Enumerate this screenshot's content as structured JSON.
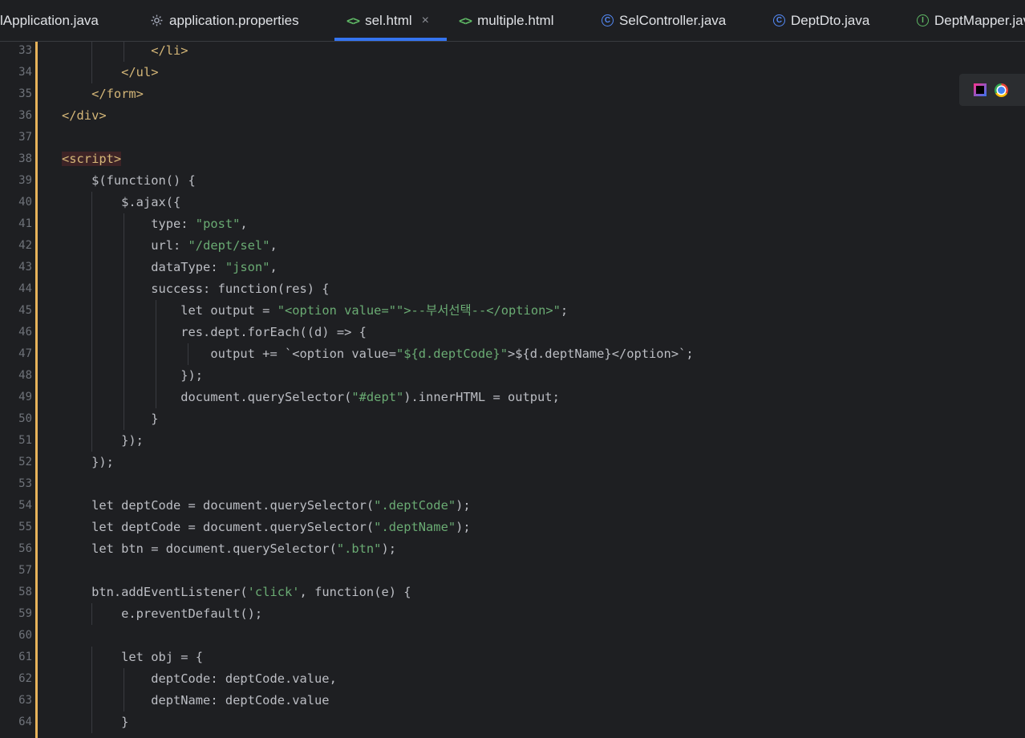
{
  "tabs": [
    {
      "label": "lApplication.java",
      "icon": "none",
      "active": false
    },
    {
      "label": "application.properties",
      "icon": "gear-icon",
      "active": false
    },
    {
      "label": "sel.html",
      "icon": "html-code-icon",
      "active": true,
      "close": "×"
    },
    {
      "label": "multiple.html",
      "icon": "html-code-icon",
      "active": false
    },
    {
      "label": "SelController.java",
      "icon": "class-icon",
      "active": false
    },
    {
      "label": "DeptDto.java",
      "icon": "class-icon",
      "active": false
    },
    {
      "label": "DeptMapper.java",
      "icon": "interface-icon",
      "active": false
    }
  ],
  "editor": {
    "lines": [
      {
        "n": "33",
        "text": "            </li>"
      },
      {
        "n": "34",
        "text": "        </ul>"
      },
      {
        "n": "35",
        "text": "    </form>"
      },
      {
        "n": "36",
        "text": "</div>"
      },
      {
        "n": "37",
        "text": ""
      },
      {
        "n": "38",
        "text": "<script>"
      },
      {
        "n": "39",
        "text": "    $(function() {"
      },
      {
        "n": "40",
        "text": "        $.ajax({"
      },
      {
        "n": "41",
        "text": "            type: \"post\","
      },
      {
        "n": "42",
        "text": "            url: \"/dept/sel\","
      },
      {
        "n": "43",
        "text": "            dataType: \"json\","
      },
      {
        "n": "44",
        "text": "            success: function(res) {"
      },
      {
        "n": "45",
        "text": "                let output = \"<option value=\"\">--부서선택--</option>\";"
      },
      {
        "n": "46",
        "text": "                res.dept.forEach((d) => {"
      },
      {
        "n": "47",
        "text": "                    output += `<option value=\"${d.deptCode}\">${d.deptName}</option>`;"
      },
      {
        "n": "48",
        "text": "                });"
      },
      {
        "n": "49",
        "text": "                document.querySelector(\"#dept\").innerHTML = output;"
      },
      {
        "n": "50",
        "text": "            }"
      },
      {
        "n": "51",
        "text": "        });"
      },
      {
        "n": "52",
        "text": "    });"
      },
      {
        "n": "53",
        "text": ""
      },
      {
        "n": "54",
        "text": "    let deptCode = document.querySelector(\".deptCode\");"
      },
      {
        "n": "55",
        "text": "    let deptCode = document.querySelector(\".deptName\");"
      },
      {
        "n": "56",
        "text": "    let btn = document.querySelector(\".btn\");"
      },
      {
        "n": "57",
        "text": ""
      },
      {
        "n": "58",
        "text": "    btn.addEventListener('click', function(e) {"
      },
      {
        "n": "59",
        "text": "        e.preventDefault();"
      },
      {
        "n": "60",
        "text": ""
      },
      {
        "n": "61",
        "text": "        let obj = {"
      },
      {
        "n": "62",
        "text": "            deptCode: deptCode.value,"
      },
      {
        "n": "63",
        "text": "            deptName: deptCode.value"
      },
      {
        "n": "64",
        "text": "        }"
      }
    ]
  },
  "colors": {
    "background": "#1e1f22",
    "accent": "#3574f0",
    "change_marker": "#e8b35a",
    "string": "#6aab73",
    "tag": "#d5b778"
  },
  "browser_icons": [
    "intellij-icon",
    "chrome-icon"
  ]
}
